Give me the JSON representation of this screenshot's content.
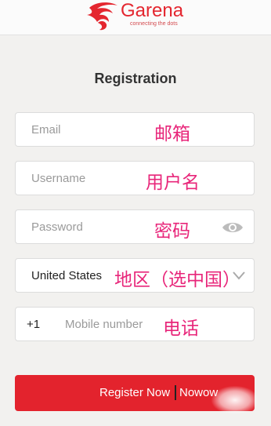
{
  "brand": {
    "name": "Garena",
    "tagline": "connecting the dots"
  },
  "form": {
    "title": "Registration",
    "email_placeholder": "Email",
    "username_placeholder": "Username",
    "password_placeholder": "Password",
    "country_value": "United States",
    "phone_prefix": "+1",
    "phone_placeholder": "Mobile number",
    "submit_label": "Register Now",
    "submit_trailing_text": "Nowow"
  },
  "annotations": {
    "email": "邮箱",
    "username": "用户名",
    "password": "密码",
    "country": "地区（选中国）",
    "phone": "电话"
  },
  "colors": {
    "brand_red": "#e3232d",
    "annotation_pink": "#e8267a"
  },
  "icons": {
    "password_toggle": "eye-icon",
    "country_dropdown": "chevron-down-icon",
    "logo": "garena-logo-icon"
  }
}
